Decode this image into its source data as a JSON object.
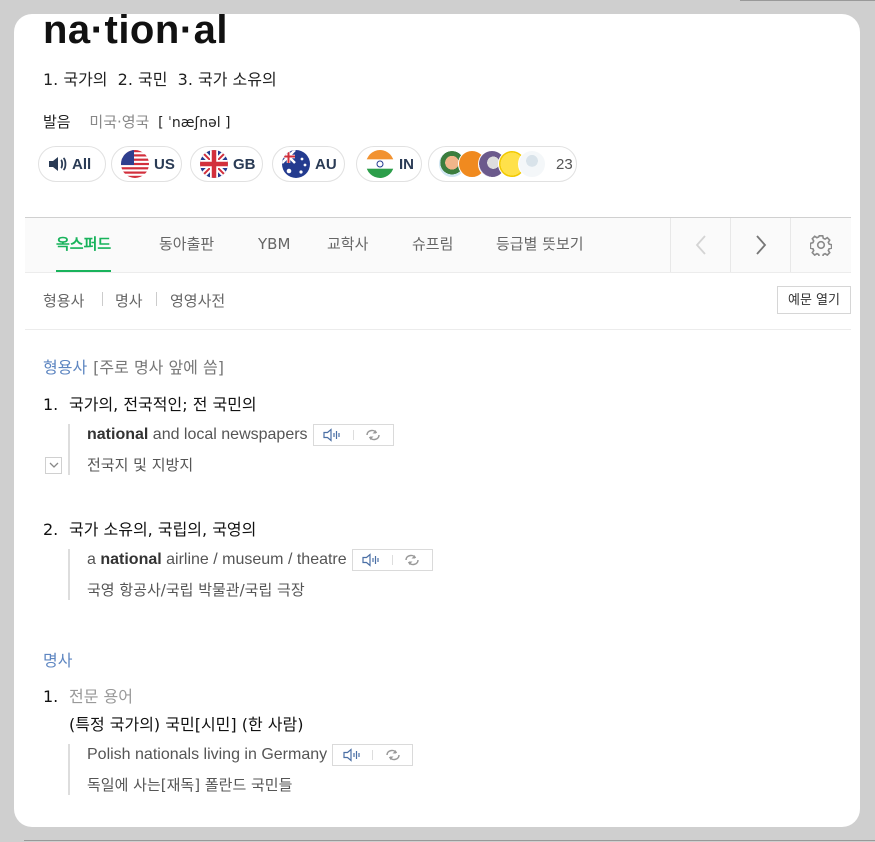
{
  "entry": {
    "word": "na·tion·al",
    "meanings": "1. 국가의  2. 국민  3. 국가 소유의"
  },
  "pronunciation": {
    "label": "발음",
    "region": "미국·영국",
    "ipa": "[ ˈnæʃnəl ]"
  },
  "audio": {
    "all_label": "All",
    "countries": [
      "US",
      "GB",
      "AU",
      "IN"
    ],
    "user_count": "23"
  },
  "tabs": {
    "items": [
      "옥스퍼드",
      "동아출판",
      "YBM",
      "교학사",
      "슈프림",
      "등급별 뜻보기"
    ],
    "active_index": 0
  },
  "subnav": {
    "items": [
      "형용사",
      "명사",
      "영영사전"
    ],
    "open_examples": "예문 열기"
  },
  "sections": {
    "adjective": {
      "pos": "형용사",
      "note": "[주로 명사 앞에 씀]",
      "senses": [
        {
          "num": "1.",
          "text": "국가의, 전국적인; 전 국민의",
          "example_pre": "",
          "example_bold": "national",
          "example_post": " and local newspapers",
          "translation": "전국지 및 지방지"
        },
        {
          "num": "2.",
          "text": "국가 소유의, 국립의, 국영의",
          "example_pre": "a ",
          "example_bold": "national",
          "example_post": " airline / museum / theatre",
          "translation": "국영 항공사/국립 박물관/국립 극장"
        }
      ]
    },
    "noun": {
      "pos": "명사",
      "senses": [
        {
          "num": "1.",
          "label": "전문 용어",
          "text": "(특정 국가의) 국민[시민] (한 사람)",
          "example": "Polish nationals living in Germany",
          "translation": "독일에 사는[재독] 폴란드 국민들"
        }
      ]
    }
  },
  "colors": {
    "accent_green": "#19b35c",
    "pos_blue": "#5e86c1",
    "flag_navy": "#2a3b55"
  }
}
